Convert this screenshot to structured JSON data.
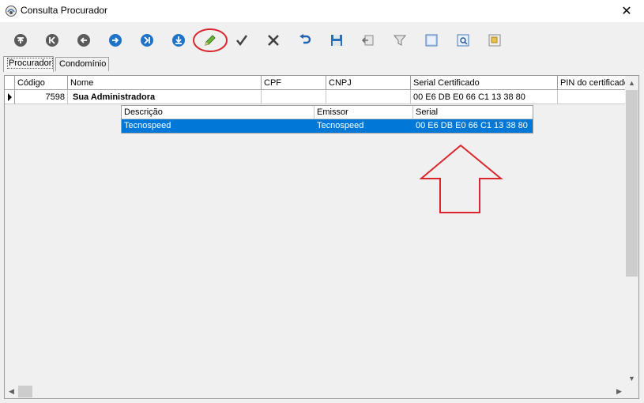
{
  "window": {
    "title": "Consulta Procurador",
    "close_glyph": "✕"
  },
  "toolbar": {
    "buttons": [
      {
        "name": "first-record-icon",
        "color": "#5a5a5a"
      },
      {
        "name": "prior-page-icon",
        "color": "#5a5a5a"
      },
      {
        "name": "prior-record-icon",
        "color": "#5a5a5a"
      },
      {
        "name": "next-record-icon",
        "color": "#1e73c8"
      },
      {
        "name": "next-page-icon",
        "color": "#1e73c8"
      },
      {
        "name": "last-record-icon",
        "color": "#1e73c8"
      },
      {
        "name": "edit-pencil-icon",
        "color": "#5aa02c"
      },
      {
        "name": "confirm-check-icon",
        "color": "#404040"
      },
      {
        "name": "cancel-x-icon",
        "color": "#404040"
      },
      {
        "name": "undo-icon",
        "color": "#1e63b4"
      },
      {
        "name": "save-icon",
        "color": "#2a6fb8"
      },
      {
        "name": "export-icon",
        "color": "#8a8a8a"
      },
      {
        "name": "filter-icon",
        "color": "#8a8a8a"
      },
      {
        "name": "print-icon",
        "color": "#4a7ab8"
      },
      {
        "name": "preview-icon",
        "color": "#4a7ab8"
      },
      {
        "name": "report-icon",
        "color": "#c8a030"
      }
    ],
    "highlight_color": "#d9262c"
  },
  "tabs": [
    {
      "label": "Procurador",
      "active": true
    },
    {
      "label": "Condomínio",
      "active": false
    }
  ],
  "grid": {
    "columns": [
      "Código",
      "Nome",
      "CPF",
      "CNPJ",
      "Serial Certificado",
      "PIN do certificado"
    ],
    "rows": [
      {
        "codigo": "7598",
        "nome": "Sua Administradora",
        "cpf": "",
        "cnpj": "",
        "serial": "00 E6 DB E0 66 C1 13 38 80",
        "pin": ""
      }
    ]
  },
  "dropdown": {
    "columns": [
      "Descrição",
      "Emissor",
      "Serial"
    ],
    "rows": [
      {
        "descricao": "Tecnospeed",
        "emissor": "Tecnospeed",
        "serial": "00 E6 DB E0 66 C1 13 38 80"
      }
    ],
    "selected_color": "#0078d7"
  },
  "annotation": {
    "arrow_color": "#d9262c"
  }
}
